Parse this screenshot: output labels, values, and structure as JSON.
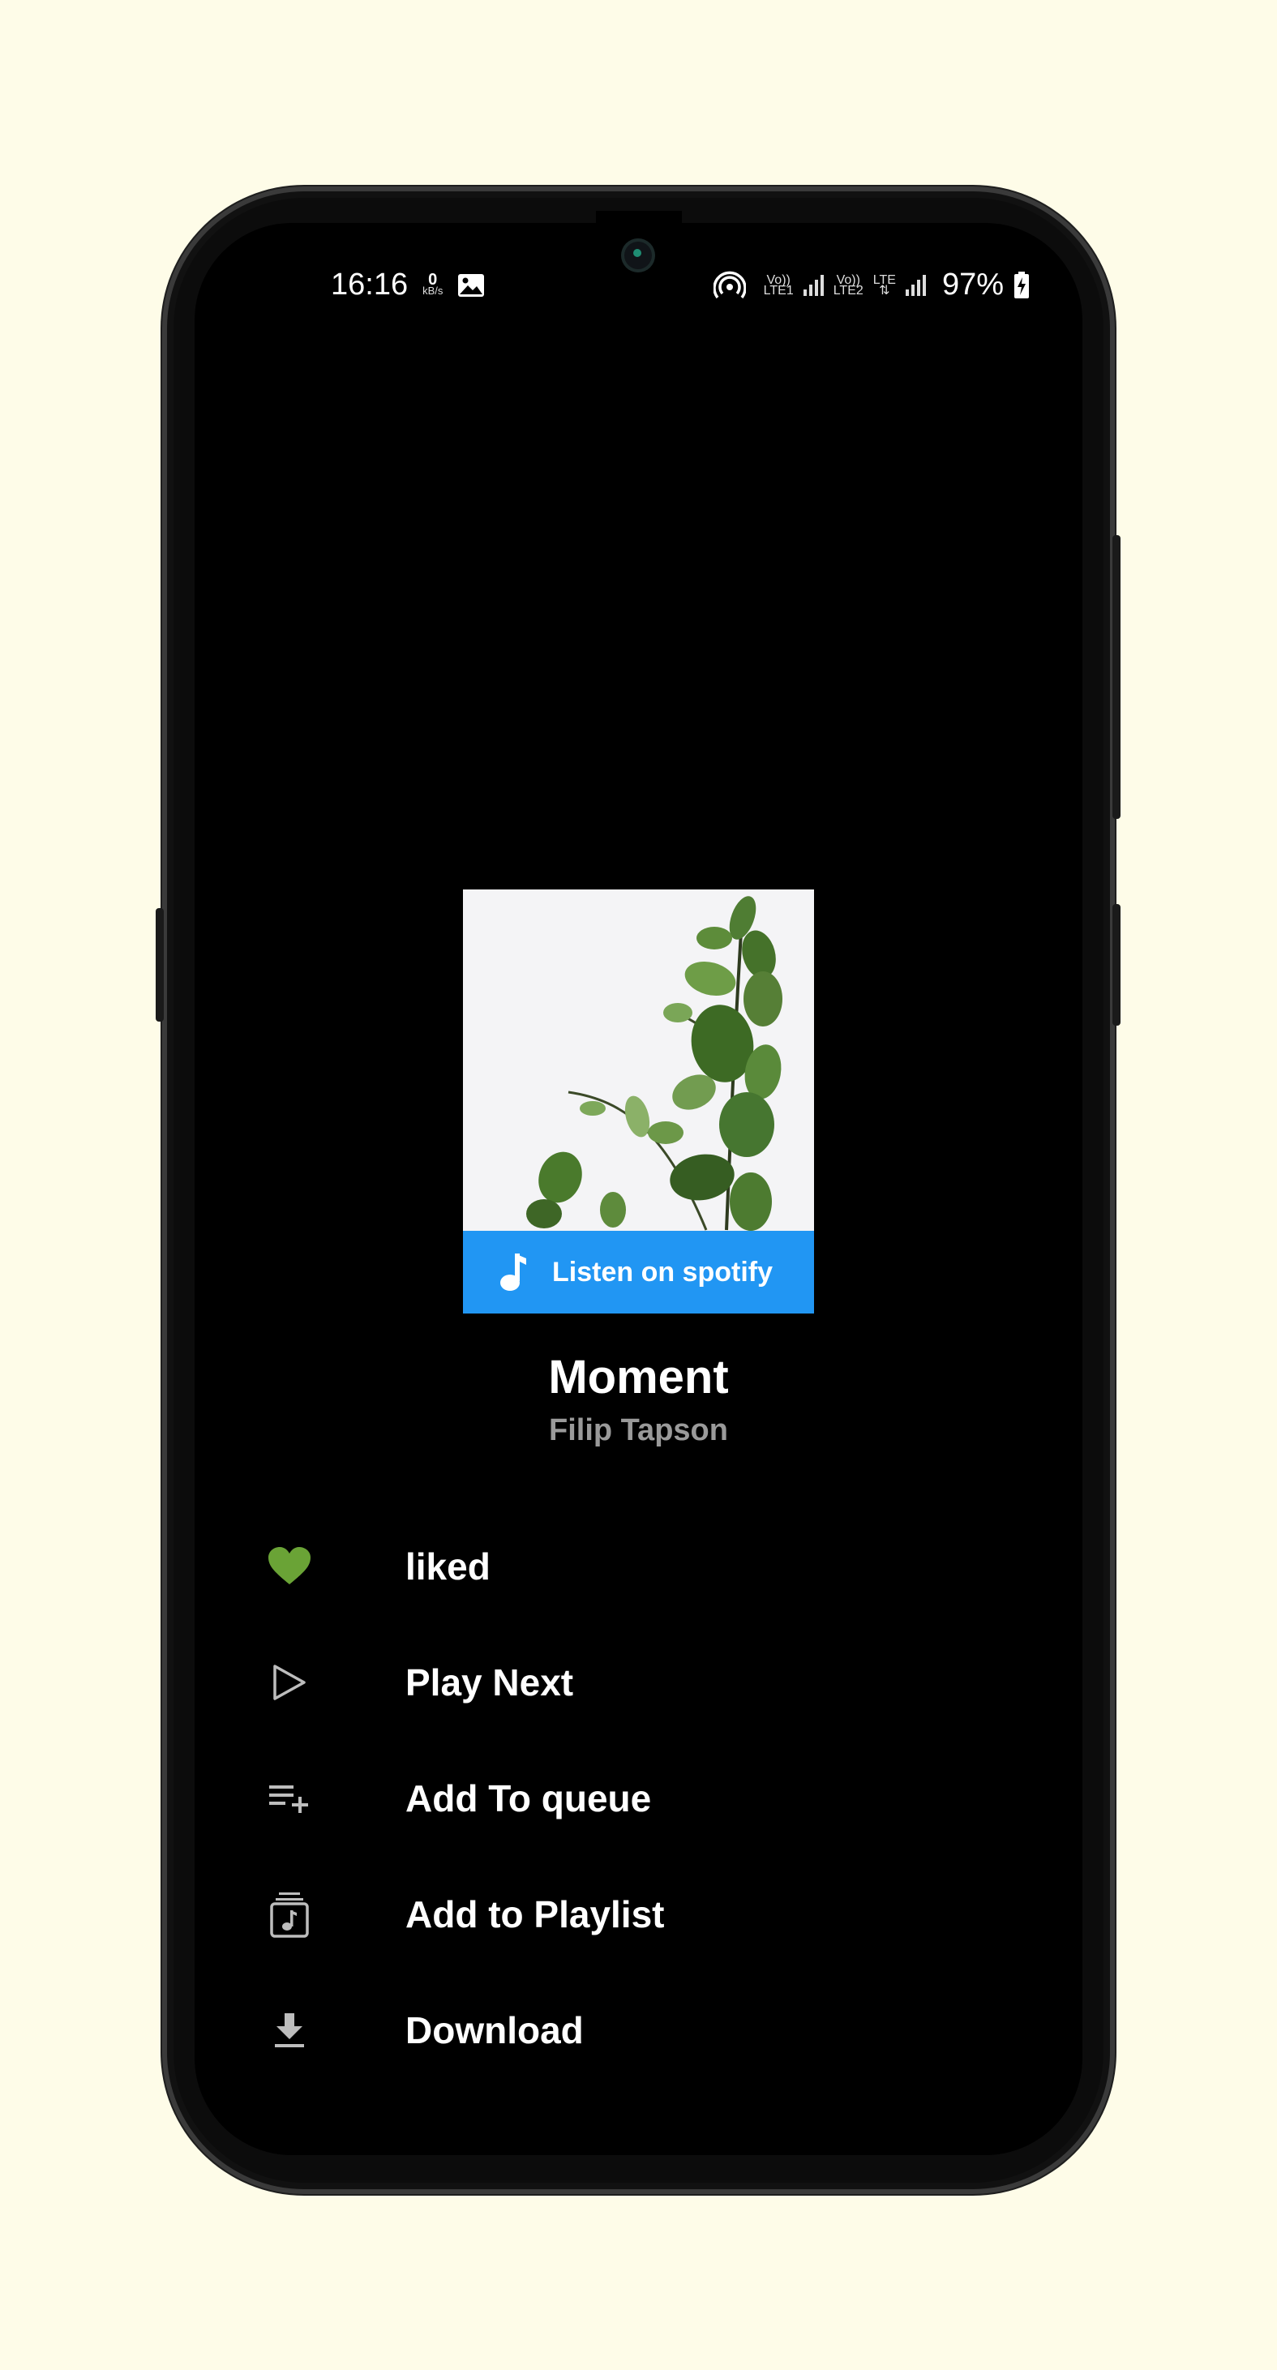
{
  "status_bar": {
    "time": "16:16",
    "net_speed_value": "0",
    "net_speed_unit": "kB/s",
    "sim1_top": "Vo))",
    "sim1_bottom": "LTE1",
    "sim2_top": "Vo))",
    "sim2_bottom": "LTE2",
    "lte": "LTE",
    "battery": "97%"
  },
  "track": {
    "spotify_label": "Listen on spotify",
    "title": "Moment",
    "artist": "Filip Tapson"
  },
  "menu": {
    "items": [
      {
        "label": "liked",
        "icon": "heart-icon"
      },
      {
        "label": "Play Next",
        "icon": "play-outline-icon"
      },
      {
        "label": "Add To queue",
        "icon": "queue-add-icon"
      },
      {
        "label": "Add to Playlist",
        "icon": "playlist-add-icon"
      },
      {
        "label": "Download",
        "icon": "download-icon"
      }
    ]
  },
  "colors": {
    "background": "#fefce8",
    "accent": "#2196f3",
    "liked": "#6aa336"
  }
}
